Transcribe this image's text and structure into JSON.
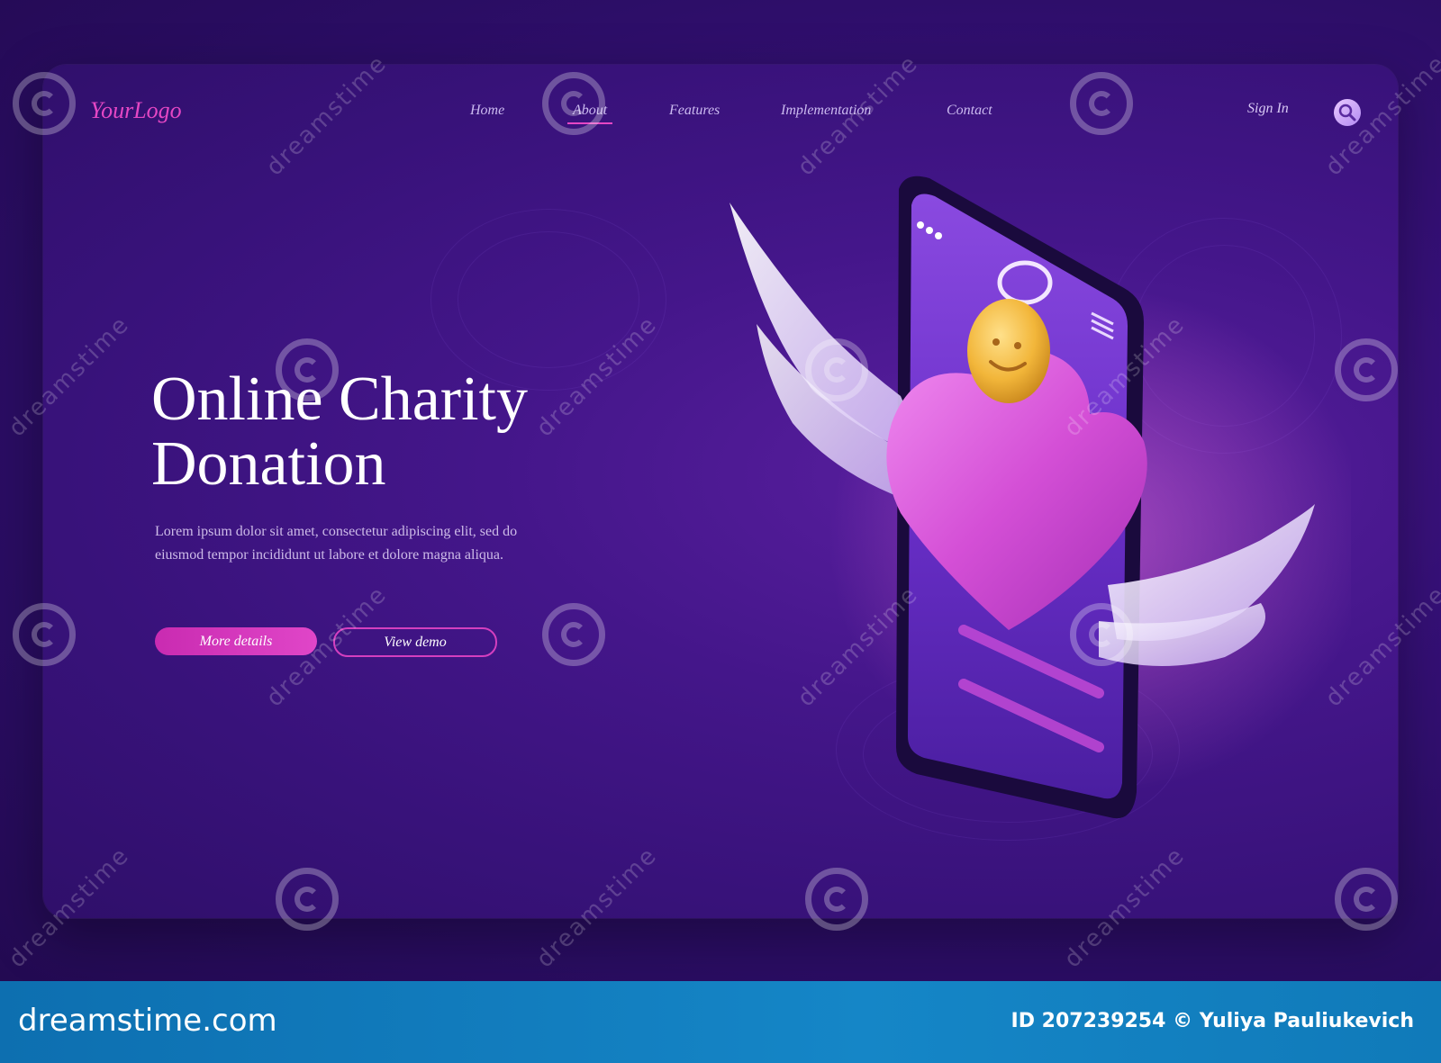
{
  "nav": {
    "logo": "YourLogo",
    "links": [
      "Home",
      "About",
      "Features",
      "Implementation",
      "Contact"
    ],
    "active": "About",
    "signin": "Sign In",
    "search_icon": "search-icon"
  },
  "hero": {
    "title_line1": "Online Charity",
    "title_line2": "Donation",
    "description": "Lorem ipsum dolor sit amet, consectetur adipiscing elit, sed do eiusmod tempor incididunt ut labore et dolore magna aliqua.",
    "primary_button": "More details",
    "secondary_button": "View demo"
  },
  "illustration": {
    "phone_icon": "smartphone-icon",
    "heart_icon": "heart-icon",
    "wing_icon": "wing-icon",
    "coin_icon": "smiley-coin-icon",
    "halo_icon": "halo-icon"
  },
  "watermark": {
    "text": "dreamstime"
  },
  "footer": {
    "brand": "dreamstime.com",
    "credit": "ID 207239254 © Yuliya Pauliukevich"
  },
  "colors": {
    "accent": "#e547c4",
    "background": "#38127a",
    "footer": "#1586c7"
  }
}
